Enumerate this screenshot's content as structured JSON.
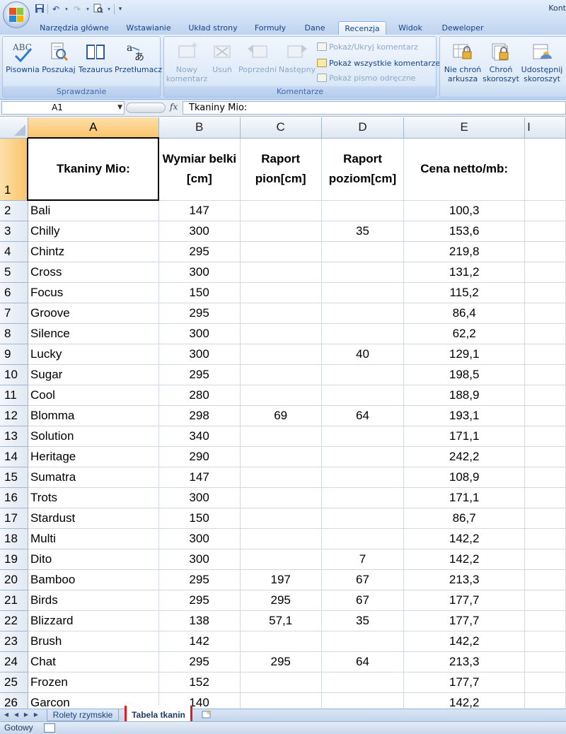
{
  "window": {
    "title_partial": "Kont"
  },
  "quick_access": {
    "icons": [
      "save-icon",
      "undo-icon",
      "redo-icon",
      "print-preview-icon",
      "customize-icon"
    ]
  },
  "tabs": [
    {
      "label": "Narzędzia główne",
      "active": false
    },
    {
      "label": "Wstawianie",
      "active": false
    },
    {
      "label": "Układ strony",
      "active": false
    },
    {
      "label": "Formuły",
      "active": false
    },
    {
      "label": "Dane",
      "active": false
    },
    {
      "label": "Recenzja",
      "active": true
    },
    {
      "label": "Widok",
      "active": false
    },
    {
      "label": "Deweloper",
      "active": false
    }
  ],
  "ribbon": {
    "groups": {
      "proofing": {
        "label": "Sprawdzanie",
        "buttons": {
          "spelling": "Pisownia",
          "research": "Poszukaj",
          "thesaurus": "Tezaurus",
          "translate": "Przetłumacz"
        }
      },
      "comments": {
        "label": "Komentarze",
        "buttons": {
          "new_l1": "Nowy",
          "new_l2": "komentarz",
          "delete": "Usuń",
          "previous": "Poprzedni",
          "next": "Następny",
          "show_hide": "Pokaż/Ukryj komentarz",
          "show_all": "Pokaż wszystkie komentarze",
          "show_ink": "Pokaż pismo odręczne"
        }
      },
      "changes": {
        "buttons": {
          "unprotect_sheet_l1": "Nie chroń",
          "unprotect_sheet_l2": "arkusza",
          "protect_workbook_l1": "Chroń",
          "protect_workbook_l2": "skoroszyt",
          "share_l1": "Udostępnij",
          "share_l2": "skoroszyt"
        }
      }
    }
  },
  "formula_bar": {
    "name_box": "A1",
    "fx": "fx",
    "formula": "Tkaniny Mio:"
  },
  "grid": {
    "columns": [
      "A",
      "B",
      "C",
      "D",
      "E"
    ],
    "header_row": {
      "row": "1",
      "a": "Tkaniny Mio:",
      "b": "Wymiar belki [cm]",
      "c": "Raport pion[cm]",
      "d": "Raport poziom[cm]",
      "e": "Cena netto/mb:"
    },
    "rows": [
      {
        "n": "2",
        "a": "Bali",
        "b": "147",
        "c": "",
        "d": "",
        "e": "100,3"
      },
      {
        "n": "3",
        "a": "Chilly",
        "b": "300",
        "c": "",
        "d": "35",
        "e": "153,6"
      },
      {
        "n": "4",
        "a": "Chintz",
        "b": "295",
        "c": "",
        "d": "",
        "e": "219,8"
      },
      {
        "n": "5",
        "a": "Cross",
        "b": "300",
        "c": "",
        "d": "",
        "e": "131,2"
      },
      {
        "n": "6",
        "a": "Focus",
        "b": "150",
        "c": "",
        "d": "",
        "e": "115,2"
      },
      {
        "n": "7",
        "a": "Groove",
        "b": "295",
        "c": "",
        "d": "",
        "e": "86,4"
      },
      {
        "n": "8",
        "a": "Silence",
        "b": "300",
        "c": "",
        "d": "",
        "e": "62,2"
      },
      {
        "n": "9",
        "a": "Lucky",
        "b": "300",
        "c": "",
        "d": "40",
        "e": "129,1"
      },
      {
        "n": "10",
        "a": "Sugar",
        "b": "295",
        "c": "",
        "d": "",
        "e": "198,5"
      },
      {
        "n": "11",
        "a": "Cool",
        "b": "280",
        "c": "",
        "d": "",
        "e": "188,9"
      },
      {
        "n": "12",
        "a": "Blomma",
        "b": "298",
        "c": "69",
        "d": "64",
        "e": "193,1"
      },
      {
        "n": "13",
        "a": "Solution",
        "b": "340",
        "c": "",
        "d": "",
        "e": "171,1"
      },
      {
        "n": "14",
        "a": "Heritage",
        "b": "290",
        "c": "",
        "d": "",
        "e": "242,2"
      },
      {
        "n": "15",
        "a": "Sumatra",
        "b": "147",
        "c": "",
        "d": "",
        "e": "108,9"
      },
      {
        "n": "16",
        "a": "Trots",
        "b": "300",
        "c": "",
        "d": "",
        "e": "171,1"
      },
      {
        "n": "17",
        "a": "Stardust",
        "b": "150",
        "c": "",
        "d": "",
        "e": "86,7"
      },
      {
        "n": "18",
        "a": "Multi",
        "b": "300",
        "c": "",
        "d": "",
        "e": "142,2"
      },
      {
        "n": "19",
        "a": "Dito",
        "b": "300",
        "c": "",
        "d": "7",
        "e": "142,2"
      },
      {
        "n": "20",
        "a": "Bamboo",
        "b": "295",
        "c": "197",
        "d": "67",
        "e": "213,3"
      },
      {
        "n": "21",
        "a": "Birds",
        "b": "295",
        "c": "295",
        "d": "67",
        "e": "177,7"
      },
      {
        "n": "22",
        "a": "Blizzard",
        "b": "138",
        "c": "57,1",
        "d": "35",
        "e": "177,7"
      },
      {
        "n": "23",
        "a": "Brush",
        "b": "142",
        "c": "",
        "d": "",
        "e": "142,2"
      },
      {
        "n": "24",
        "a": "Chat",
        "b": "295",
        "c": "295",
        "d": "64",
        "e": "213,3"
      },
      {
        "n": "25",
        "a": "Frozen",
        "b": "152",
        "c": "",
        "d": "",
        "e": "177,7"
      },
      {
        "n": "26",
        "a": "Garcon",
        "b": "140",
        "c": "",
        "d": "",
        "e": "142,2"
      }
    ]
  },
  "sheet_tabs": [
    {
      "label": "Rolety rzymskie",
      "active": false
    },
    {
      "label": "Tabela tkanin",
      "active": true
    }
  ],
  "status": {
    "text": "Gotowy"
  },
  "colors": {
    "ribbon_blue": "#15428b",
    "selection_orange": "#fbc46b",
    "highlight_red": "#e01b24"
  }
}
